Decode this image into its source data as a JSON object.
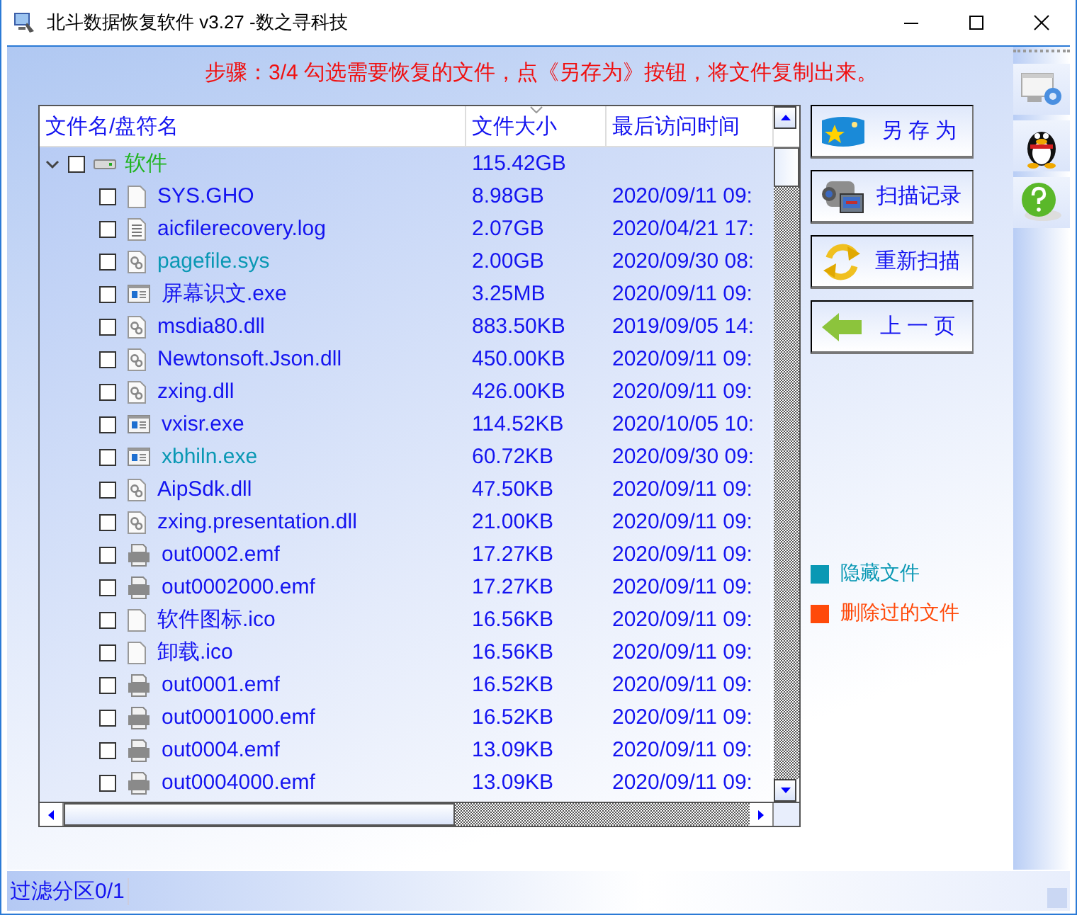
{
  "window": {
    "title": "北斗数据恢复软件 v3.27 -数之寻科技"
  },
  "instruction": "步骤：3/4 勾选需要恢复的文件，点《另存为》按钮，将文件复制出来。",
  "table": {
    "columns": [
      "文件名/盘符名",
      "文件大小",
      "最后访问时间"
    ],
    "root": {
      "name": "软件",
      "size": "115.42GB",
      "checked": false,
      "expanded": true,
      "children": [
        {
          "name": "SYS.GHO",
          "size": "8.98GB",
          "date": "2020/09/11 09:",
          "kind": "blank",
          "hidden": false,
          "checked": false
        },
        {
          "name": "aicfilerecovery.log",
          "size": "2.07GB",
          "date": "2020/04/21 17:",
          "kind": "text",
          "hidden": false,
          "checked": false
        },
        {
          "name": "pagefile.sys",
          "size": "2.00GB",
          "date": "2020/09/30 08:",
          "kind": "dll",
          "hidden": true,
          "checked": false
        },
        {
          "name": "屏幕识文.exe",
          "size": "3.25MB",
          "date": "2020/09/11 09:",
          "kind": "exe",
          "hidden": false,
          "checked": false
        },
        {
          "name": "msdia80.dll",
          "size": "883.50KB",
          "date": "2019/09/05 14:",
          "kind": "dll",
          "hidden": false,
          "checked": false
        },
        {
          "name": "Newtonsoft.Json.dll",
          "size": "450.00KB",
          "date": "2020/09/11 09:",
          "kind": "dll",
          "hidden": false,
          "checked": false
        },
        {
          "name": "zxing.dll",
          "size": "426.00KB",
          "date": "2020/09/11 09:",
          "kind": "dll",
          "hidden": false,
          "checked": false
        },
        {
          "name": "vxisr.exe",
          "size": "114.52KB",
          "date": "2020/10/05 10:",
          "kind": "exe",
          "hidden": false,
          "checked": false
        },
        {
          "name": "xbhiln.exe",
          "size": "60.72KB",
          "date": "2020/09/30 09:",
          "kind": "exe",
          "hidden": true,
          "checked": false
        },
        {
          "name": "AipSdk.dll",
          "size": "47.50KB",
          "date": "2020/09/11 09:",
          "kind": "dll",
          "hidden": false,
          "checked": false
        },
        {
          "name": "zxing.presentation.dll",
          "size": "21.00KB",
          "date": "2020/09/11 09:",
          "kind": "dll",
          "hidden": false,
          "checked": false
        },
        {
          "name": "out0002.emf",
          "size": "17.27KB",
          "date": "2020/09/11 09:",
          "kind": "emf",
          "hidden": false,
          "checked": false
        },
        {
          "name": "out0002000.emf",
          "size": "17.27KB",
          "date": "2020/09/11 09:",
          "kind": "emf",
          "hidden": false,
          "checked": false
        },
        {
          "name": "软件图标.ico",
          "size": "16.56KB",
          "date": "2020/09/11 09:",
          "kind": "blank",
          "hidden": false,
          "checked": false
        },
        {
          "name": "卸载.ico",
          "size": "16.56KB",
          "date": "2020/09/11 09:",
          "kind": "blank",
          "hidden": false,
          "checked": false
        },
        {
          "name": "out0001.emf",
          "size": "16.52KB",
          "date": "2020/09/11 09:",
          "kind": "emf",
          "hidden": false,
          "checked": false
        },
        {
          "name": "out0001000.emf",
          "size": "16.52KB",
          "date": "2020/09/11 09:",
          "kind": "emf",
          "hidden": false,
          "checked": false
        },
        {
          "name": "out0004.emf",
          "size": "13.09KB",
          "date": "2020/09/11 09:",
          "kind": "emf",
          "hidden": false,
          "checked": false
        },
        {
          "name": "out0004000.emf",
          "size": "13.09KB",
          "date": "2020/09/11 09:",
          "kind": "emf",
          "hidden": false,
          "checked": false
        }
      ]
    }
  },
  "buttons": [
    {
      "label": "另 存 为",
      "kind": "save"
    },
    {
      "label": "扫描记录",
      "kind": "camera"
    },
    {
      "label": "重新扫描",
      "kind": "refresh"
    },
    {
      "label": "上 一 页",
      "kind": "back"
    }
  ],
  "legend": [
    {
      "label": "隐藏文件",
      "color": "#0a98b4"
    },
    {
      "label": "删除过的文件",
      "color": "#ff4a0a"
    }
  ],
  "status_bar": "过滤分区0/1"
}
